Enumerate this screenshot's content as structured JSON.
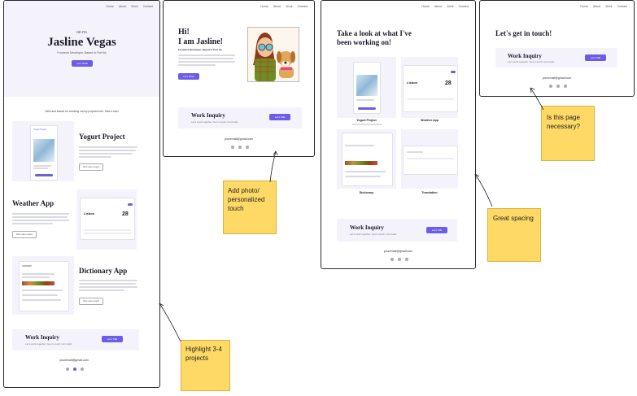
{
  "frame1": {
    "nav": [
      "Home",
      "About",
      "Work",
      "Contact"
    ],
    "greeting": "Hi! I'm",
    "name": "Jasline Vegas",
    "subtitle": "Frontend Developer, Based in Port Ita",
    "hero_button": "Let's Work",
    "intro": "Hello and thanks for checking out my projects here. Take a look!",
    "projects": [
      {
        "title": "Yogurt Project",
        "button": "View case project"
      },
      {
        "title": "Weather App",
        "button": "View case project"
      },
      {
        "title": "Dictionary App",
        "button": "View case project"
      }
    ],
    "yogurt_mock_title": "Yogurt Project",
    "weather_city": "Lisbon",
    "weather_temp": "28",
    "inquiry_title": "Work Inquiry",
    "inquiry_text": "Let's work together. Get in touch, let's build.",
    "inquiry_button": "Let's Talk",
    "email": "youremail@gmail.com"
  },
  "frame2": {
    "nav": [
      "Home",
      "About",
      "Work",
      "Contact"
    ],
    "heading_line1": "Hi!",
    "heading_line2": "I am Jasline!",
    "role": "Frontend Developer, Based in Port Ita",
    "button": "Let's Work",
    "inquiry_title": "Work Inquiry",
    "inquiry_text": "Let's work together. Get in touch, let's build.",
    "inquiry_button": "Let's Talk",
    "email": "youremail@gmail.com"
  },
  "frame3": {
    "nav": [
      "Home",
      "About",
      "Work",
      "Contact"
    ],
    "heading_line1": "Take a look at what I've",
    "heading_line2": "been working on!",
    "projects": [
      {
        "title": "Yogurt Project"
      },
      {
        "title": "Weather App"
      },
      {
        "title": "Dictionary"
      },
      {
        "title": "Translation"
      }
    ],
    "weather_city": "Lisbon",
    "weather_temp": "28",
    "inquiry_title": "Work Inquiry",
    "inquiry_text": "Let's work together. Get in touch, let's build.",
    "inquiry_button": "Let's Talk",
    "email": "youremail@gmail.com"
  },
  "frame4": {
    "nav": [
      "Home",
      "About",
      "Work",
      "Contact"
    ],
    "heading": "Let's get in touch!",
    "inquiry_title": "Work Inquiry",
    "inquiry_text": "Let's work together. Get in touch, let's build.",
    "inquiry_button": "Let's Talk",
    "email": "youremail@gmail.com"
  },
  "notes": {
    "highlight": "Highlight 3-4 projects",
    "photo": "Add photo/ personalized touch",
    "spacing": "Great spacing",
    "necessary": "Is this page necessary?"
  },
  "colors": {
    "accent": "#6c5ce7",
    "sticky": "#ffd966",
    "panel": "#f4f3fb"
  }
}
